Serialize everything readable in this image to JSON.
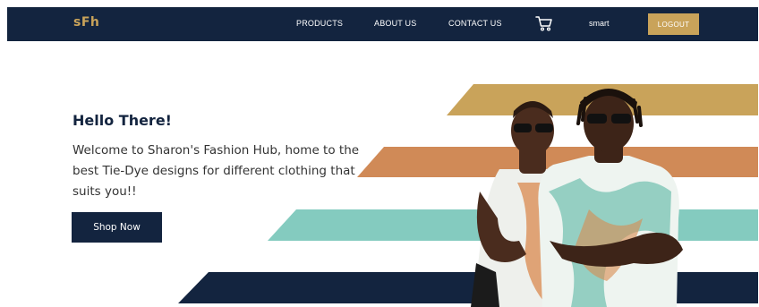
{
  "brand": {
    "logo": "sFh",
    "accent_color": "#c9a35a",
    "nav_color": "#13243f"
  },
  "nav": {
    "links": [
      {
        "label": "PRODUCTS"
      },
      {
        "label": "ABOUT US"
      },
      {
        "label": "CONTACT US"
      }
    ],
    "cart_icon": "shopping-cart-icon",
    "username": "smart",
    "logout_label": "LOGOUT"
  },
  "hero": {
    "title": "Hello There!",
    "text": "Welcome to Sharon's Fashion Hub, home to the best Tie-Dye designs for different clothing that suits you!!",
    "cta_label": "Shop Now",
    "stripe_colors": [
      "#c9a35a",
      "#d08a57",
      "#84cbbf",
      "#13243f"
    ]
  }
}
